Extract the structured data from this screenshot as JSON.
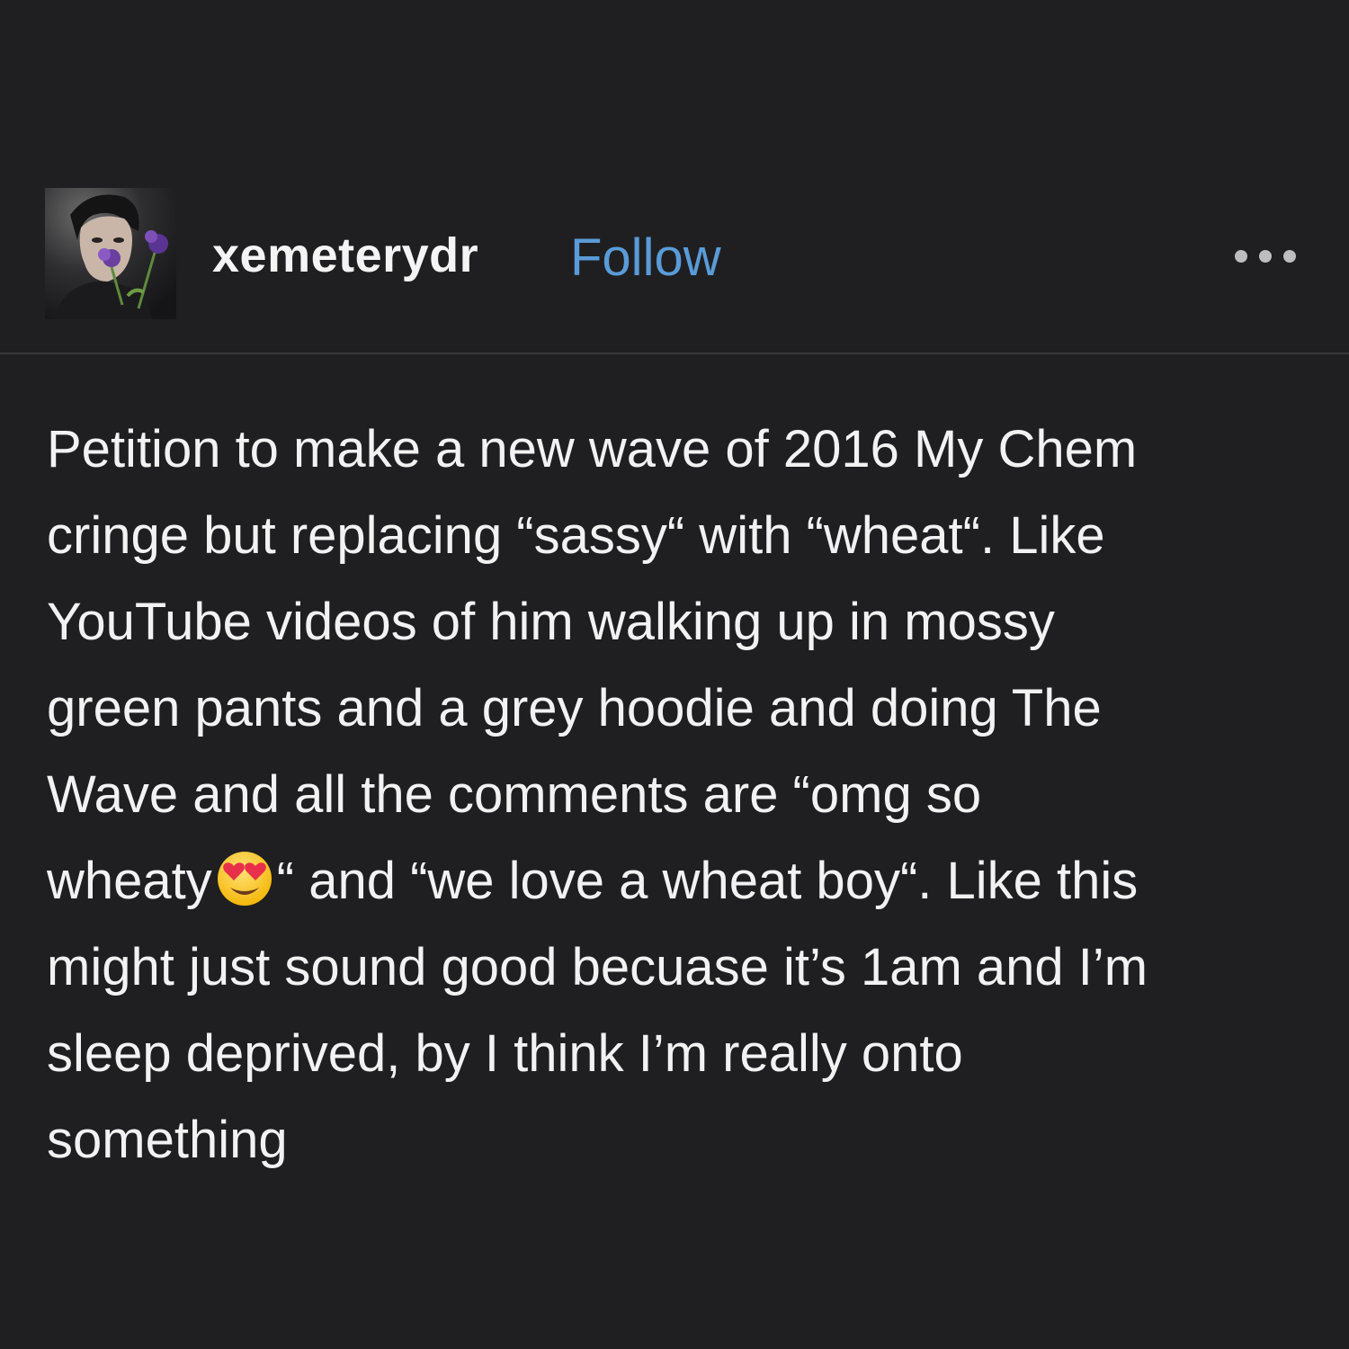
{
  "post": {
    "username": "xemeterydr",
    "follow_label": "Follow",
    "more_icon": "more-horizontal-icon",
    "avatar_icon": "user-avatar",
    "colors": {
      "background": "#1f1f21",
      "text": "#f2f2f2",
      "follow": "#5a9bd8",
      "divider": "#3a3a3c"
    },
    "body_lines": [
      "Petition to make a new wave of 2016 My Chem",
      "cringe but replacing “sassy“ with “wheat“. Like",
      "YouTube videos of him walking up in mossy",
      "green pants and a grey hoodie and doing The",
      "Wave and all the comments are “omg so",
      "“ and “we love a wheat boy“. Like this",
      "might just sound good becuase it’s 1am and I’m",
      "sleep deprived, by I think I’m really onto",
      "something"
    ],
    "line6_prefix": "wheaty",
    "emoji_icon": "heart-eyes-emoji-icon"
  }
}
